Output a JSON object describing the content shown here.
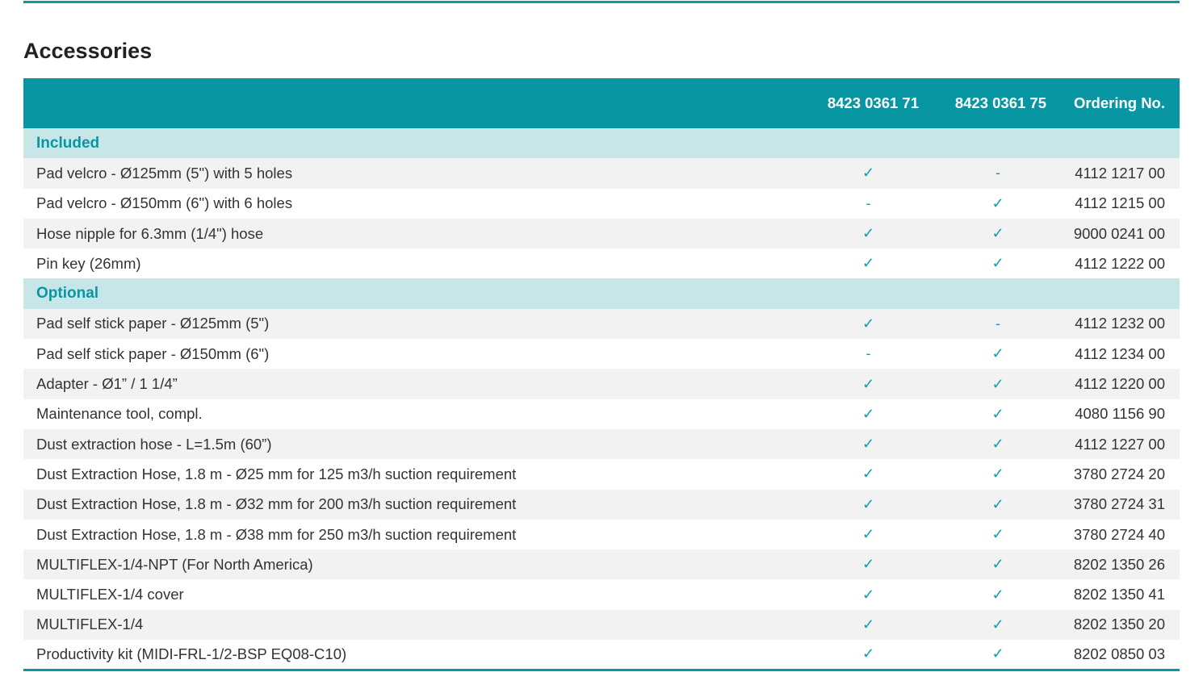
{
  "section": {
    "title": "Accessories"
  },
  "colors": {
    "accent": "#0897a2",
    "group_band": "#c7e6e8",
    "row_alt": "#f2f2f2",
    "check": "#0aa2b0"
  },
  "table": {
    "headers": {
      "description": "",
      "model_a": "8423 0361 71",
      "model_b": "8423 0361 75",
      "ordering": "Ordering No."
    },
    "groups": [
      {
        "label": "Included",
        "rows": [
          {
            "name": "Pad velcro - Ø125mm (5\") with 5 holes",
            "a": "✓",
            "b": "-",
            "ordering": "4112 1217 00"
          },
          {
            "name": "Pad velcro - Ø150mm (6\") with 6 holes",
            "a": "-",
            "b": "✓",
            "ordering": "4112 1215 00"
          },
          {
            "name": "Hose nipple for 6.3mm (1/4\") hose",
            "a": "✓",
            "b": "✓",
            "ordering": "9000 0241 00"
          },
          {
            "name": "Pin key (26mm)",
            "a": "✓",
            "b": "✓",
            "ordering": "4112 1222 00"
          }
        ]
      },
      {
        "label": "Optional",
        "rows": [
          {
            "name": "Pad self stick paper - Ø125mm (5\")",
            "a": "✓",
            "b": "-",
            "ordering": "4112 1232 00"
          },
          {
            "name": "Pad self stick paper - Ø150mm (6\")",
            "a": "-",
            "b": "✓",
            "ordering": "4112 1234 00"
          },
          {
            "name": "Adapter - Ø1” / 1 1/4”",
            "a": "✓",
            "b": "✓",
            "ordering": "4112 1220 00"
          },
          {
            "name": "Maintenance tool, compl.",
            "a": "✓",
            "b": "✓",
            "ordering": "4080 1156 90"
          },
          {
            "name": "Dust extraction hose - L=1.5m (60”)",
            "a": "✓",
            "b": "✓",
            "ordering": "4112 1227 00"
          },
          {
            "name": "Dust Extraction Hose, 1.8 m - Ø25 mm for 125 m3/h suction requirement",
            "a": "✓",
            "b": "✓",
            "ordering": "3780 2724 20"
          },
          {
            "name": "Dust Extraction Hose, 1.8 m - Ø32 mm for 200 m3/h suction requirement",
            "a": "✓",
            "b": "✓",
            "ordering": "3780 2724 31"
          },
          {
            "name": "Dust Extraction Hose, 1.8 m - Ø38 mm for 250 m3/h suction requirement",
            "a": "✓",
            "b": "✓",
            "ordering": "3780 2724 40"
          },
          {
            "name": "MULTIFLEX-1/4-NPT (For North America)",
            "a": "✓",
            "b": "✓",
            "ordering": "8202 1350 26"
          },
          {
            "name": "MULTIFLEX-1/4 cover",
            "a": "✓",
            "b": "✓",
            "ordering": "8202 1350 41"
          },
          {
            "name": "MULTIFLEX-1/4",
            "a": "✓",
            "b": "✓",
            "ordering": "8202 1350 20"
          },
          {
            "name": "Productivity kit (MIDI-FRL-1/2-BSP EQ08-C10)",
            "a": "✓",
            "b": "✓",
            "ordering": "8202 0850 03"
          }
        ]
      }
    ]
  }
}
